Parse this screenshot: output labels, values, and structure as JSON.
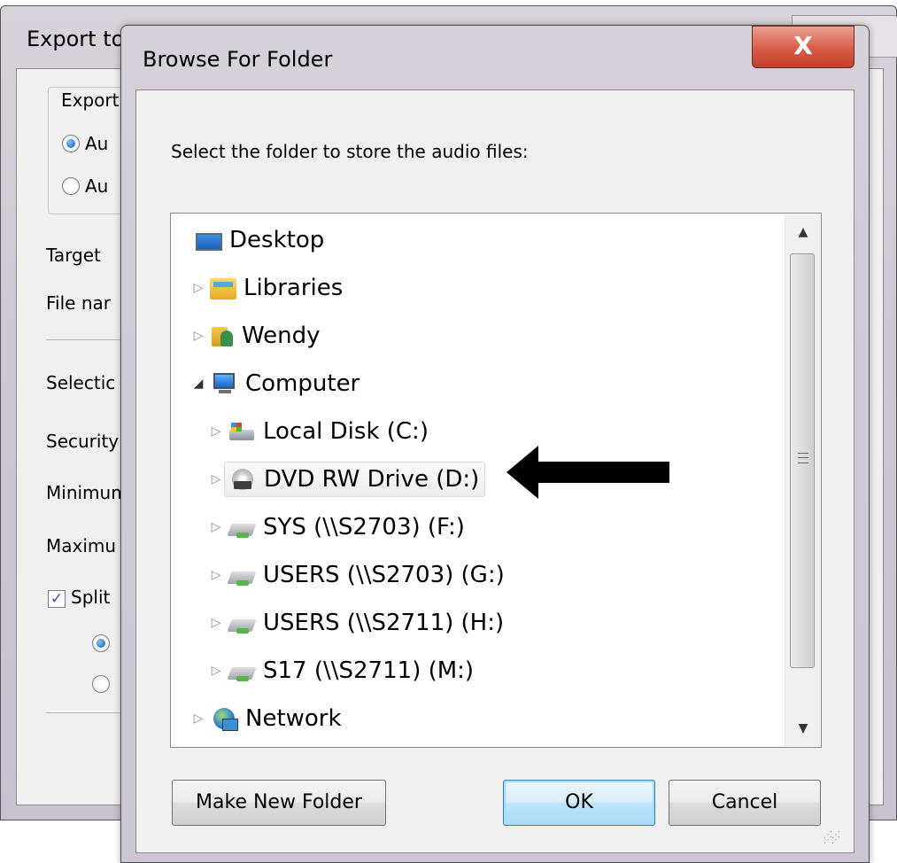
{
  "background_window": {
    "title": "Export to",
    "group_title": "Export",
    "radio_1": "Au",
    "radio_2": "Au",
    "labels": [
      "Target",
      "File nar",
      "Selectic",
      "Security",
      "Minimum",
      "Maximu"
    ],
    "split_checkbox": "Split",
    "split_checked": true
  },
  "dialog": {
    "title": "Browse For Folder",
    "close_glyph": "X",
    "instruction": "Select the folder to store the audio files:",
    "tree": [
      {
        "label": "Desktop",
        "icon": "desktop-icon",
        "expander": "",
        "indent": 0
      },
      {
        "label": "Libraries",
        "icon": "libraries-icon",
        "expander": "▷",
        "indent": 1
      },
      {
        "label": "Wendy",
        "icon": "user-folder-icon",
        "expander": "▷",
        "indent": 1
      },
      {
        "label": "Computer",
        "icon": "computer-icon",
        "expander": "◢",
        "indent": 1
      },
      {
        "label": "Local Disk (C:)",
        "icon": "local-disk-icon",
        "expander": "▷",
        "indent": 2
      },
      {
        "label": "DVD RW Drive (D:)",
        "icon": "dvd-drive-icon",
        "expander": "▷",
        "indent": 2,
        "selected": true
      },
      {
        "label": "SYS (\\\\S2703) (F:)",
        "icon": "network-drive-icon",
        "expander": "▷",
        "indent": 2
      },
      {
        "label": "USERS (\\\\S2703) (G:)",
        "icon": "network-drive-icon",
        "expander": "▷",
        "indent": 2
      },
      {
        "label": "USERS (\\\\S2711) (H:)",
        "icon": "network-drive-icon",
        "expander": "▷",
        "indent": 2
      },
      {
        "label": "S17 (\\\\S2711) (M:)",
        "icon": "network-drive-icon",
        "expander": "▷",
        "indent": 2
      },
      {
        "label": "Network",
        "icon": "network-icon",
        "expander": "▷",
        "indent": 1
      }
    ],
    "buttons": {
      "make_new_folder": "Make New Folder",
      "ok": "OK",
      "cancel": "Cancel"
    },
    "scroll": {
      "up": "▲",
      "down": "▼"
    }
  },
  "colors": {
    "close_red": "#c94530",
    "default_button_blue": "#a6daf6",
    "annotation_arrow": "#000000"
  }
}
